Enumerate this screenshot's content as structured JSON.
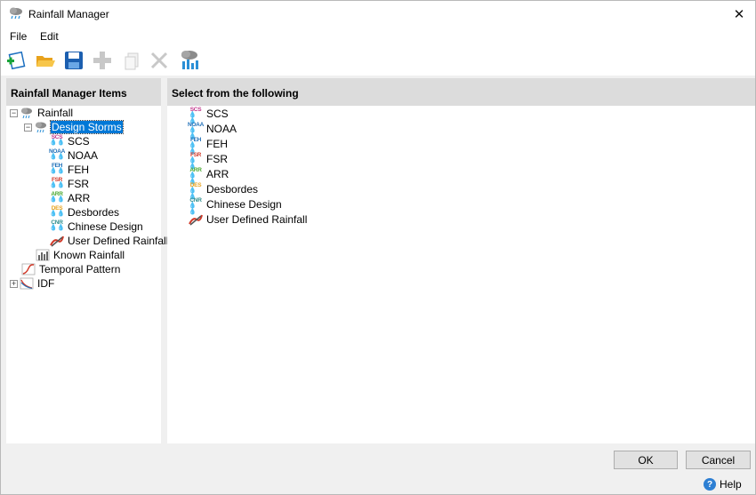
{
  "window": {
    "title": "Rainfall Manager",
    "close_glyph": "✕"
  },
  "menu": {
    "file": "File",
    "edit": "Edit"
  },
  "toolbar": {
    "buttons": [
      {
        "name": "new-icon"
      },
      {
        "name": "open-folder-icon"
      },
      {
        "name": "save-icon"
      },
      {
        "name": "add-icon"
      },
      {
        "name": "copy-icon"
      },
      {
        "name": "delete-icon"
      },
      {
        "name": "rainfall-chart-icon"
      }
    ]
  },
  "left_panel": {
    "header": "Rainfall Manager Items",
    "tree": {
      "rainfall": "Rainfall",
      "design_storms": "Design Storms",
      "scs": "SCS",
      "noaa": "NOAA",
      "feh": "FEH",
      "fsr": "FSR",
      "arr": "ARR",
      "desbordes": "Desbordes",
      "chinese": "Chinese Design",
      "user_defined": "User Defined Rainfall",
      "known": "Known Rainfall",
      "temporal": "Temporal Pattern",
      "idf": "IDF"
    }
  },
  "right_panel": {
    "header": "Select from the following",
    "items": [
      "SCS",
      "NOAA",
      "FEH",
      "FSR",
      "ARR",
      "Desbordes",
      "Chinese Design",
      "User Defined Rainfall"
    ]
  },
  "icons": {
    "scs": {
      "code": "SCS",
      "color": "#c0338a"
    },
    "noaa": {
      "code": "NOAA",
      "color": "#1f6fb8"
    },
    "feh": {
      "code": "FEH",
      "color": "#1f6fb8"
    },
    "fsr": {
      "code": "FSR",
      "color": "#d23a2a"
    },
    "arr": {
      "code": "ARR",
      "color": "#4aa830"
    },
    "des": {
      "code": "DES",
      "color": "#e7a21b"
    },
    "cnr": {
      "code": "CNR",
      "color": "#2d8d8d"
    }
  },
  "buttons": {
    "ok": "OK",
    "cancel": "Cancel",
    "help": "Help",
    "help_glyph": "?"
  }
}
